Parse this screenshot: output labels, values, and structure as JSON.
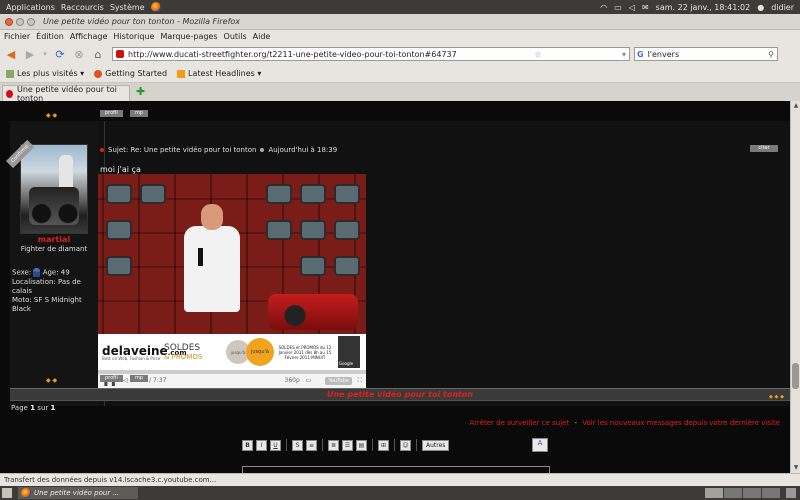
{
  "system_bar": {
    "menus": [
      "Applications",
      "Raccourcis",
      "Système"
    ],
    "datetime": "sam. 22 janv., 18:41:02",
    "user": "didier"
  },
  "window": {
    "title": "Une petite vidéo pour ton tonton - Mozilla Firefox"
  },
  "menu_bar": [
    "Fichier",
    "Édition",
    "Affichage",
    "Historique",
    "Marque-pages",
    "Outils",
    "Aide"
  ],
  "nav": {
    "url": "http://www.ducati-streetfighter.org/t2211-une-petite-video-pour-toi-tonton#64737",
    "search_value": "l'envers"
  },
  "bookmarks": [
    "Les plus visités ▾",
    "Getting Started",
    "Latest Headlines ▾"
  ],
  "tab": {
    "label": "Une petite vidéo pour toi tonton"
  },
  "post": {
    "buttons": {
      "profile": "profil",
      "pm": "mp",
      "quote": "citer"
    },
    "ribbon": "Confirmé",
    "author": "martial",
    "rank": "Fighter de diamant",
    "profile_lines": [
      "Sexe: ",
      "Age: 49",
      "Localisation: Pas de calais",
      "Moto: SF S Midnight Black"
    ],
    "subject": "Sujet: Re: Une petite vidéo pour toi tonton",
    "date": "Aujourd'hui à 18:39",
    "text": "moi j'ai ça"
  },
  "video": {
    "ad_brand": "delaveine",
    "ad_brand_tld": ".com",
    "ad_tagline": "Best on Web, Fashion & Price",
    "ad_soldes": "SOLDES",
    "ad_promos": "& PROMOS",
    "ad_circle1": "jusqu'à",
    "ad_circle2": "jusqu'à",
    "ad_dates": "SOLDES et PROMOS du 12 Janvier 2011 dès 8h au 15 Février 2011 MINUIT",
    "ad_google": "Google",
    "time": "0:15 / 7:37",
    "quality": "360p",
    "youtube": "YouTube"
  },
  "thread": {
    "title": "Une petite vidéo pour toi tonton",
    "page_label": "Page",
    "page_num": "1",
    "page_of": "sur",
    "page_total": "1",
    "stop_watch": "Arrêter de surveiller ce sujet",
    "new_messages": "Voir les nouveaux messages depuis votre dernière visite",
    "separator": "-"
  },
  "editor": {
    "buttons": [
      "B",
      "I",
      "U",
      "S",
      "≡",
      "≣",
      "☰",
      "▤",
      "⊞",
      "☺"
    ],
    "autres": "Autres",
    "a_button": "A"
  },
  "status": "Transfert des données depuis v14.lscache3.c.youtube.com...",
  "taskbar": {
    "task": "Une petite vidéo pour ..."
  },
  "colors": {
    "accent": "#e02020",
    "arrows": "#e9a010",
    "page_bg": "#0a0a0a"
  }
}
